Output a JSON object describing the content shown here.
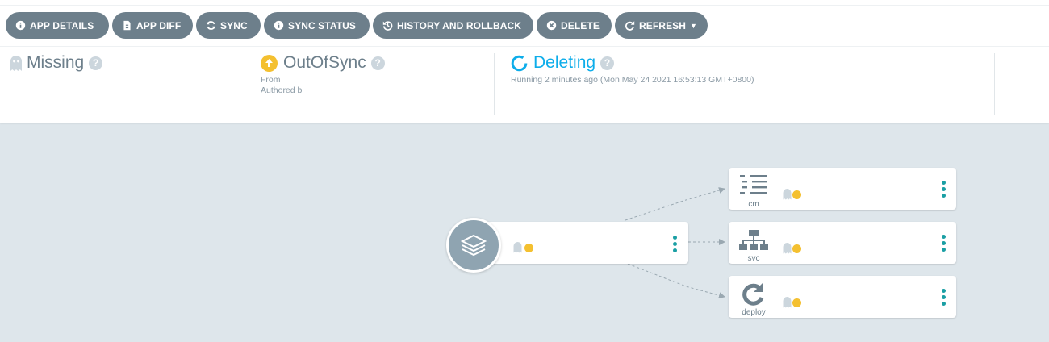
{
  "toolbar": {
    "buttons": [
      {
        "label": "APP DETAILS",
        "icon": "info-circle-icon"
      },
      {
        "label": "APP DIFF",
        "icon": "file-diff-icon"
      },
      {
        "label": "SYNC",
        "icon": "sync-icon"
      },
      {
        "label": "SYNC STATUS",
        "icon": "info-circle-icon"
      },
      {
        "label": "HISTORY AND ROLLBACK",
        "icon": "history-icon"
      },
      {
        "label": "DELETE",
        "icon": "times-circle-icon"
      },
      {
        "label": "REFRESH",
        "icon": "redo-icon"
      }
    ]
  },
  "status": {
    "health": {
      "title": "Missing",
      "help": "?"
    },
    "sync": {
      "title": "OutOfSync",
      "help": "?",
      "from": "From",
      "authored": "Authored b"
    },
    "operation": {
      "title": "Deleting",
      "help": "?",
      "detail": "Running 2 minutes ago (Mon May 24 2021 16:53:13 GMT+0800)"
    }
  },
  "graph": {
    "resources": [
      {
        "kind": "cm",
        "icon": "configmap-icon"
      },
      {
        "kind": "svc",
        "icon": "service-icon"
      },
      {
        "kind": "deploy",
        "icon": "deployment-icon"
      }
    ]
  },
  "colors": {
    "button_bg": "#6d7f8b",
    "missing": "#ccd6dd",
    "out_of_sync": "#f4c030",
    "progressing": "#0dadea",
    "kebab": "#1a9fa4",
    "canvas_bg": "#dee6eb"
  }
}
